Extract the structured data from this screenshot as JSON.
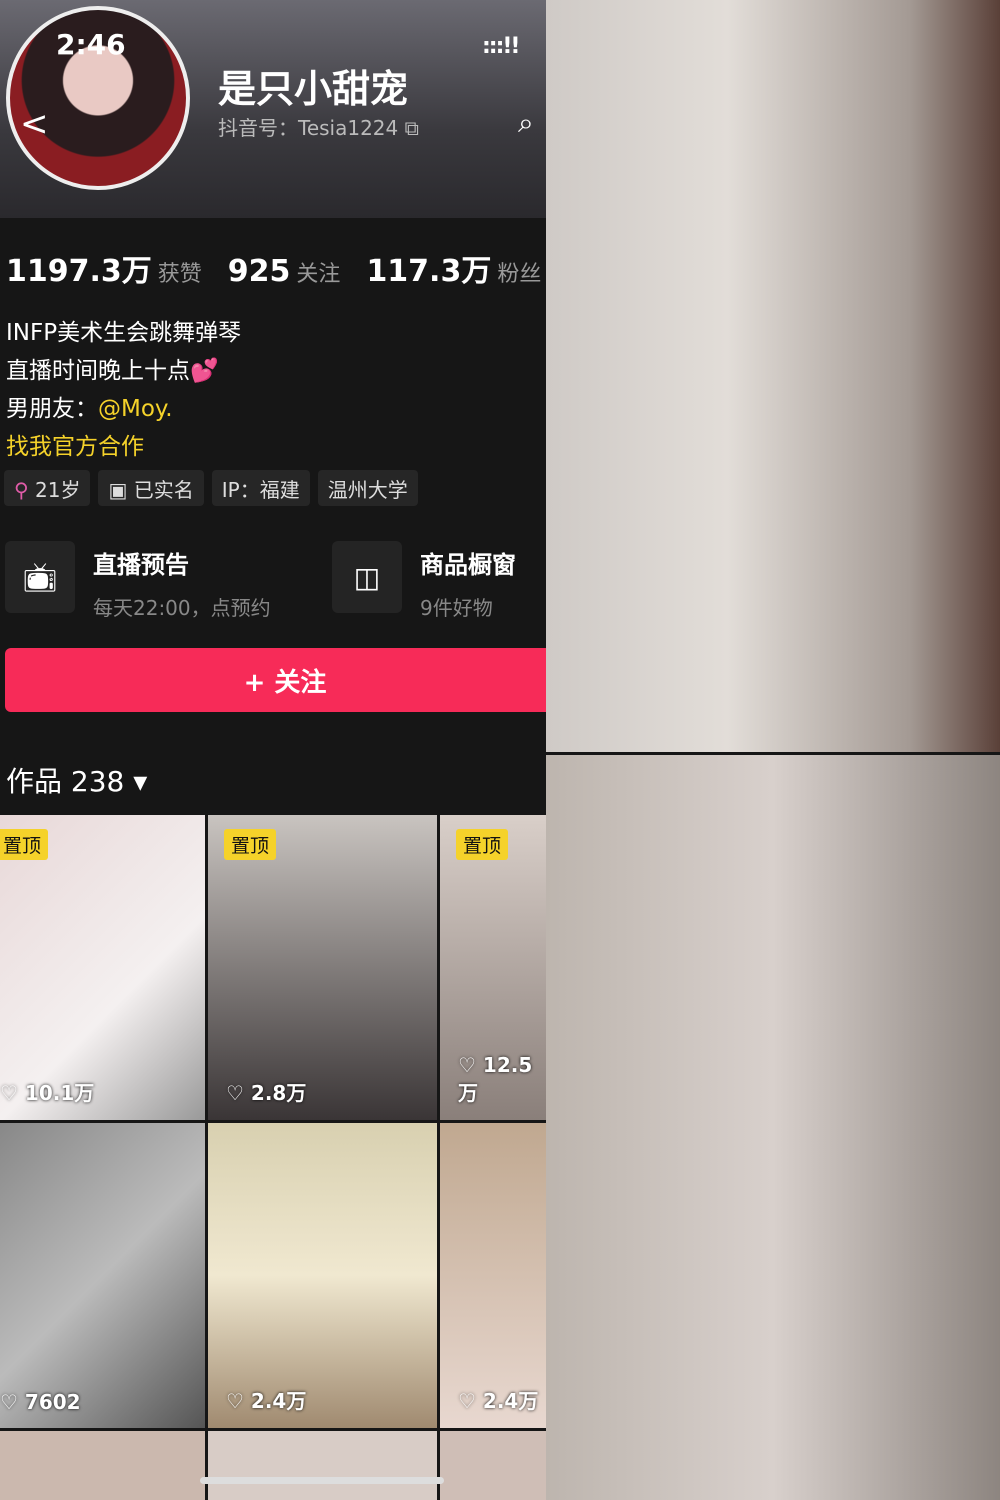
{
  "status": {
    "time": "2:46",
    "signal": ":::!!"
  },
  "profile": {
    "name": "是只小甜宠",
    "douyin_id": "抖音号：Tesia1224"
  },
  "stats": [
    {
      "value": "1197.3万",
      "label": "获赞"
    },
    {
      "value": "925",
      "label": "关注"
    },
    {
      "value": "117.3万",
      "label": "粉丝"
    }
  ],
  "bio": {
    "line1": "INFP美术生会跳舞弹琴",
    "line2": "直播时间晚上十点💕",
    "line3_prefix": "男朋友：",
    "line3_link": "@Moy.",
    "line4": "找我官方合作"
  },
  "tags": {
    "age": "21岁",
    "verified": "已实名",
    "ip": "IP：福建",
    "school": "温州大学"
  },
  "live": {
    "title": "直播预告",
    "sub": "每天22:00，点预约"
  },
  "shop": {
    "title": "商品橱窗",
    "sub": "9件好物"
  },
  "follow_label": "+ 关注",
  "works_label": "作品 238 ▾",
  "pinned_label": "置顶",
  "videos": [
    {
      "likes": "10.1万",
      "pinned": true
    },
    {
      "likes": "2.8万",
      "pinned": true
    },
    {
      "likes": "12.5万",
      "pinned": true
    },
    {
      "likes": "7602"
    },
    {
      "likes": "2.4万"
    },
    {
      "likes": "2.4万"
    }
  ]
}
